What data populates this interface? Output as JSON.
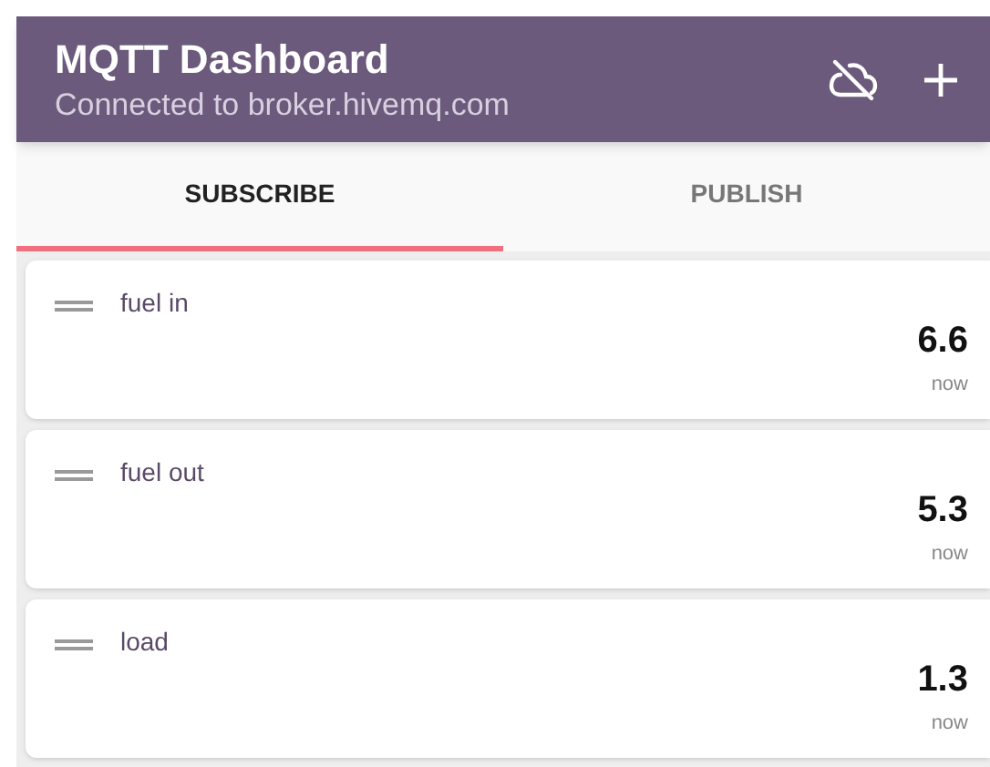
{
  "app_bar": {
    "title": "MQTT Dashboard",
    "subtitle": "Connected to broker.hivemq.com"
  },
  "tabs": [
    {
      "label": "SUBSCRIBE",
      "selected": true
    },
    {
      "label": "PUBLISH",
      "selected": false
    }
  ],
  "subscriptions": [
    {
      "topic": "fuel in",
      "value": "6.6",
      "time": "now"
    },
    {
      "topic": "fuel out",
      "value": "5.3",
      "time": "now"
    },
    {
      "topic": "load",
      "value": "1.3",
      "time": "now"
    }
  ]
}
